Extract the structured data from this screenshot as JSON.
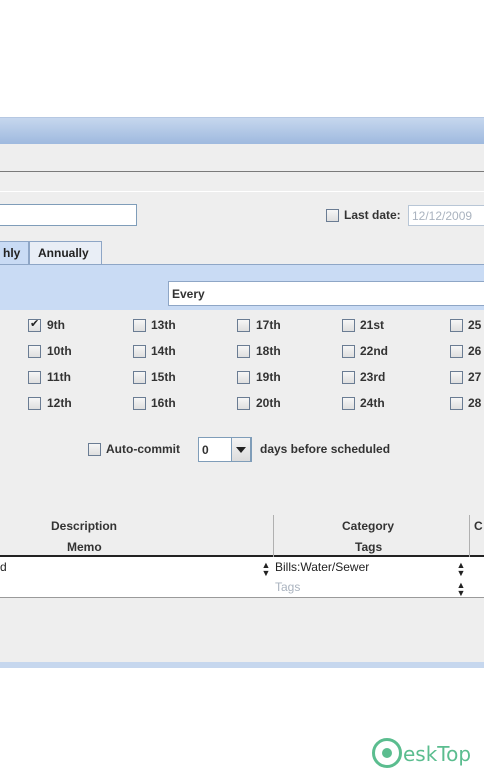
{
  "colors": {
    "accent": "#c6d7ee",
    "watermark": "#5bbd8f",
    "disabled_text": "#aab3bf"
  },
  "last_date": {
    "label": "Last date:",
    "value": "12/12/2009",
    "checked": false
  },
  "tabs": [
    {
      "label": "hly",
      "selected": true
    },
    {
      "label": "Annually",
      "selected": false
    }
  ],
  "frequency": {
    "value": "Every"
  },
  "days": {
    "col1": [
      {
        "label": "9th",
        "checked": true
      },
      {
        "label": "10th",
        "checked": false
      },
      {
        "label": "11th",
        "checked": false
      },
      {
        "label": "12th",
        "checked": false
      }
    ],
    "col2": [
      {
        "label": "13th"
      },
      {
        "label": "14th"
      },
      {
        "label": "15th"
      },
      {
        "label": "16th"
      }
    ],
    "col3": [
      {
        "label": "17th"
      },
      {
        "label": "18th"
      },
      {
        "label": "19th"
      },
      {
        "label": "20th"
      }
    ],
    "col4": [
      {
        "label": "21st"
      },
      {
        "label": "22nd"
      },
      {
        "label": "23rd"
      },
      {
        "label": "24th"
      }
    ],
    "col5": [
      {
        "label": "25"
      },
      {
        "label": "26"
      },
      {
        "label": "27"
      },
      {
        "label": "28"
      }
    ]
  },
  "autocommit": {
    "label": "Auto-commit",
    "checked": false,
    "value": "0",
    "suffix": "days before scheduled"
  },
  "table": {
    "headers": {
      "description": "Description",
      "memo": "Memo",
      "category": "Category",
      "tags": "Tags",
      "c": "C"
    },
    "row": {
      "description": "d",
      "category": "Bills:Water/Sewer",
      "tags_placeholder": "Tags"
    }
  },
  "watermark": {
    "icon": "desktop-logo-icon",
    "text": "DeskTop",
    "first_letter": "D",
    "rest": "eskTop"
  }
}
